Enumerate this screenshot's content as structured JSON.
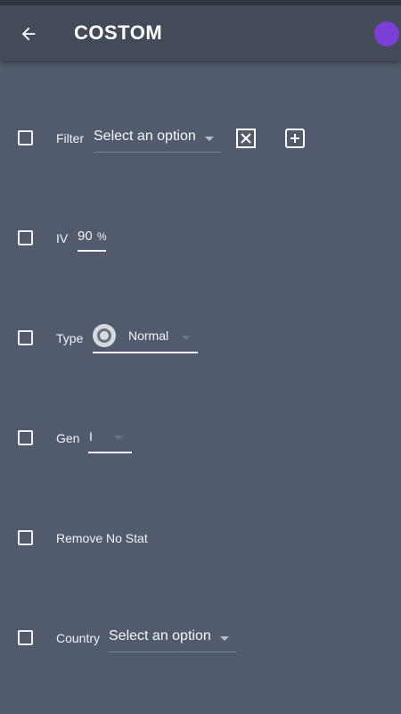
{
  "header": {
    "title": "COSTOM"
  },
  "filter_row": {
    "label": "Filter",
    "select_value": "Select an option"
  },
  "iv_row": {
    "label": "IV",
    "value": "90",
    "unit": "%"
  },
  "type_row": {
    "label": "Type",
    "value": "Normal"
  },
  "gen_row": {
    "label": "Gen",
    "value": "I"
  },
  "remove_row": {
    "label": "Remove No Stat"
  },
  "country_row": {
    "label": "Country",
    "select_value": "Select an option"
  },
  "colors": {
    "background": "#525b6d",
    "appbar": "#434a58",
    "accent": "#7b3fd6"
  },
  "icons": {
    "back": "arrow-left-icon",
    "clear": "close-box-icon",
    "add": "plus-box-icon",
    "type": "normal-type-icon",
    "dropdown": "caret-down-icon"
  }
}
